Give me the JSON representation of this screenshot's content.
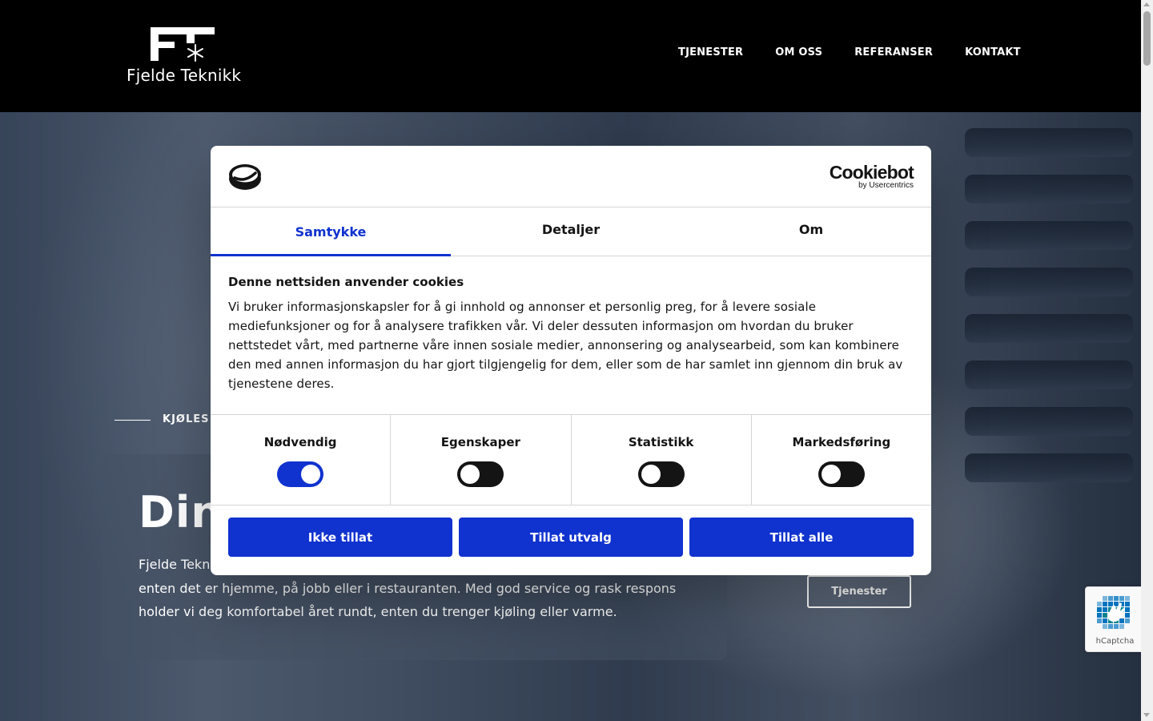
{
  "site": {
    "logo_text": "Fjelde Teknikk",
    "nav": [
      "TJENESTER",
      "OM OSS",
      "REFERANSER",
      "KONTAKT"
    ]
  },
  "hero": {
    "eyebrow": "KJØLES",
    "title": "Din",
    "text": "Fjelde Teknikk ... enten det er hjemme, på jobb eller i restauranten. Med god service og rask respons holder vi deg komfortabel året rundt, enten du trenger kjøling eller varme.",
    "text_line1": "Fjelde Tekn",
    "text_line2": "enten det er hjemme, på jobb eller i restauranten. Med god service og rask respons",
    "text_line3": "holder vi deg komfortabel året rundt, enten du trenger kjøling eller varme.",
    "button": "Tjenester"
  },
  "cookie_dialog": {
    "brand": "Cookiebot",
    "brand_sub": "by Usercentrics",
    "tabs": [
      {
        "label": "Samtykke",
        "active": true
      },
      {
        "label": "Detaljer",
        "active": false
      },
      {
        "label": "Om",
        "active": false
      }
    ],
    "heading": "Denne nettsiden anvender cookies",
    "body": "Vi bruker informasjonskapsler for å gi innhold og annonser et personlig preg, for å levere sosiale mediefunksjoner og for å analysere trafikken vår. Vi deler dessuten informasjon om hvordan du bruker nettstedet vårt, med partnerne våre innen sosiale medier, annonsering og analysearbeid, som kan kombinere den med annen informasjon du har gjort tilgjengelig for dem, eller som de har samlet inn gjennom din bruk av tjenestene deres.",
    "toggles": [
      {
        "label": "Nødvendig",
        "on": true
      },
      {
        "label": "Egenskaper",
        "on": false
      },
      {
        "label": "Statistikk",
        "on": false
      },
      {
        "label": "Markedsføring",
        "on": false
      }
    ],
    "buttons": [
      "Ikke tillat",
      "Tillat utvalg",
      "Tillat alle"
    ],
    "accent_color": "#1032cf"
  },
  "hcaptcha": {
    "label": "hCaptcha"
  }
}
